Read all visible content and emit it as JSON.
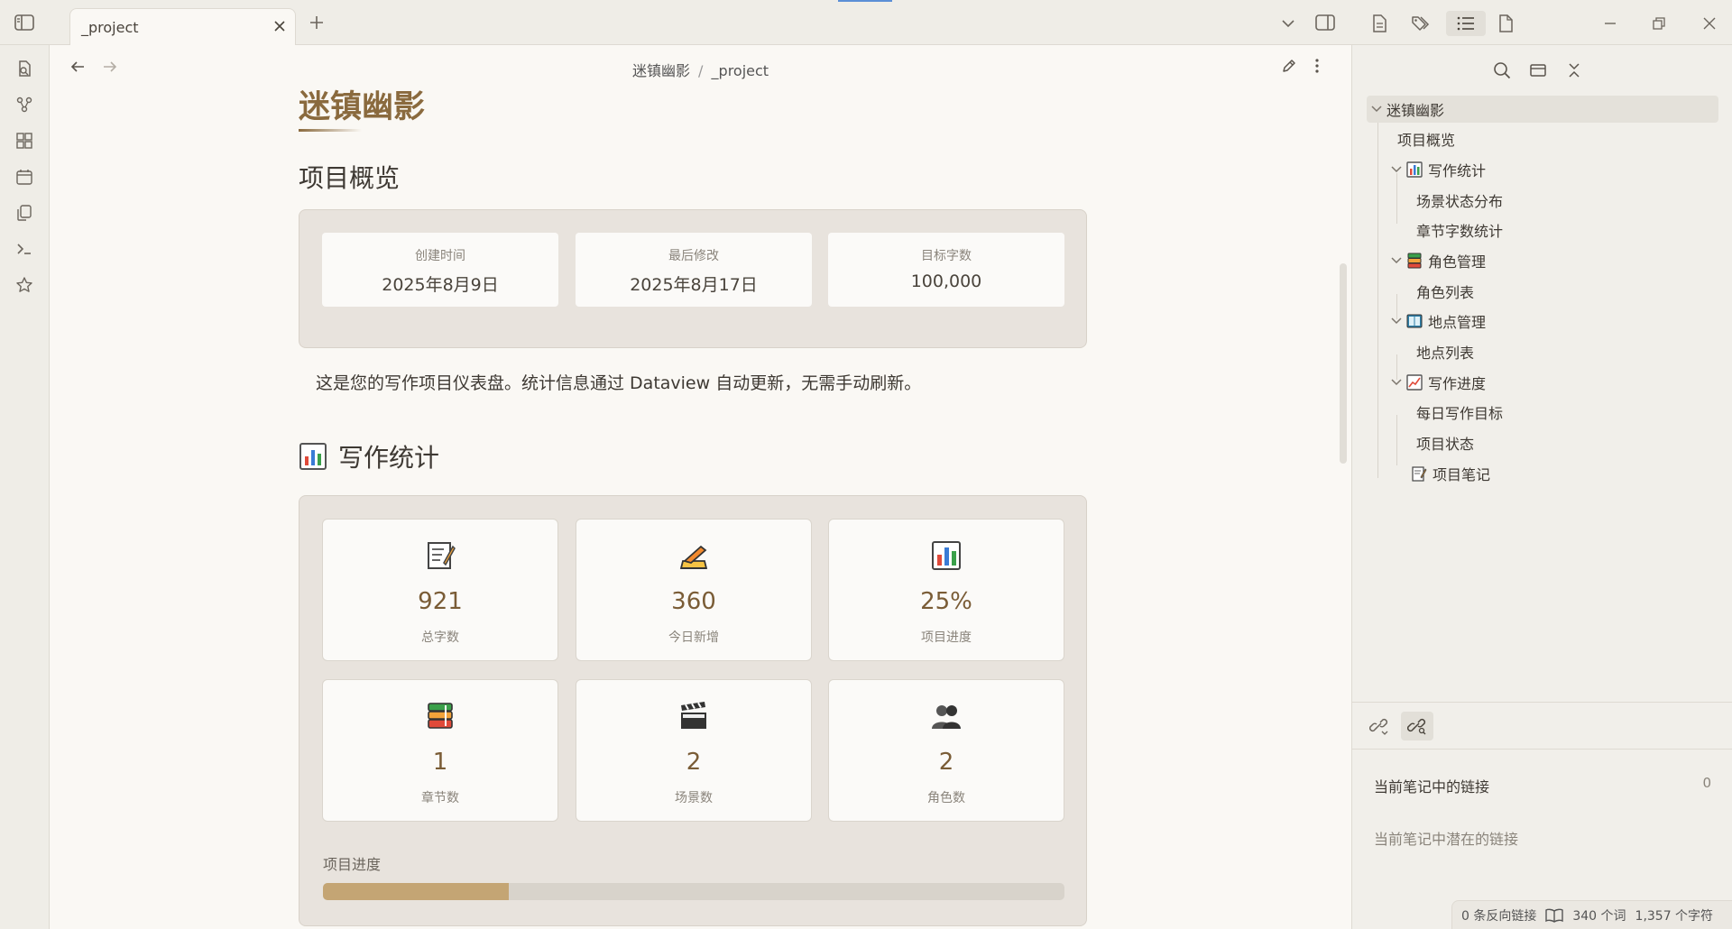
{
  "tab": {
    "title": "_project"
  },
  "breadcrumb": {
    "folder": "迷镇幽影",
    "separator": "/",
    "file": "_project"
  },
  "note": {
    "title": "迷镇幽影",
    "overview": {
      "heading": "项目概览",
      "cards": [
        {
          "label": "创建时间",
          "value": "2025年8月9日"
        },
        {
          "label": "最后修改",
          "value": "2025年8月17日"
        },
        {
          "label": "目标字数",
          "value": "100,000"
        }
      ]
    },
    "description": "这是您的写作项目仪表盘。统计信息通过 Dataview 自动更新，无需手动刷新。",
    "stats": {
      "heading": "写作统计",
      "cards": [
        {
          "icon": "memo-icon",
          "value": "921",
          "label": "总字数"
        },
        {
          "icon": "writing-hand-icon",
          "value": "360",
          "label": "今日新增"
        },
        {
          "icon": "bar-chart-icon",
          "value": "25%",
          "label": "项目进度"
        },
        {
          "icon": "books-icon",
          "value": "1",
          "label": "章节数"
        },
        {
          "icon": "clapper-icon",
          "value": "2",
          "label": "场景数"
        },
        {
          "icon": "people-icon",
          "value": "2",
          "label": "角色数"
        }
      ],
      "progress_label": "项目进度"
    }
  },
  "outline": {
    "root": "迷镇幽影",
    "items": [
      {
        "level": 1,
        "label": "项目概览"
      },
      {
        "level": 1,
        "label": "写作统计",
        "icon": "bar-chart-icon",
        "collapsible": true
      },
      {
        "level": 2,
        "label": "场景状态分布"
      },
      {
        "level": 2,
        "label": "章节字数统计"
      },
      {
        "level": 1,
        "label": "角色管理",
        "icon": "books-icon",
        "collapsible": true
      },
      {
        "level": 2,
        "label": "角色列表"
      },
      {
        "level": 1,
        "label": "地点管理",
        "icon": "open-book-icon",
        "collapsible": true
      },
      {
        "level": 2,
        "label": "地点列表"
      },
      {
        "level": 1,
        "label": "写作进度",
        "icon": "chart-increasing-icon",
        "collapsible": true
      },
      {
        "level": 2,
        "label": "每日写作目标"
      },
      {
        "level": 2,
        "label": "项目状态"
      },
      {
        "level": 1,
        "label": "项目笔记",
        "icon": "memo-icon"
      }
    ]
  },
  "links": {
    "current_links": "当前笔记中的链接",
    "current_count": "0",
    "potential_links": "当前笔记中潜在的链接"
  },
  "status": {
    "backlinks": "0 条反向链接",
    "words": "340 个词",
    "chars": "1,357 个字符"
  },
  "colors": {
    "accent": "#8a6a3e",
    "panel": "#e8e3dd",
    "background": "#faf8f4"
  }
}
